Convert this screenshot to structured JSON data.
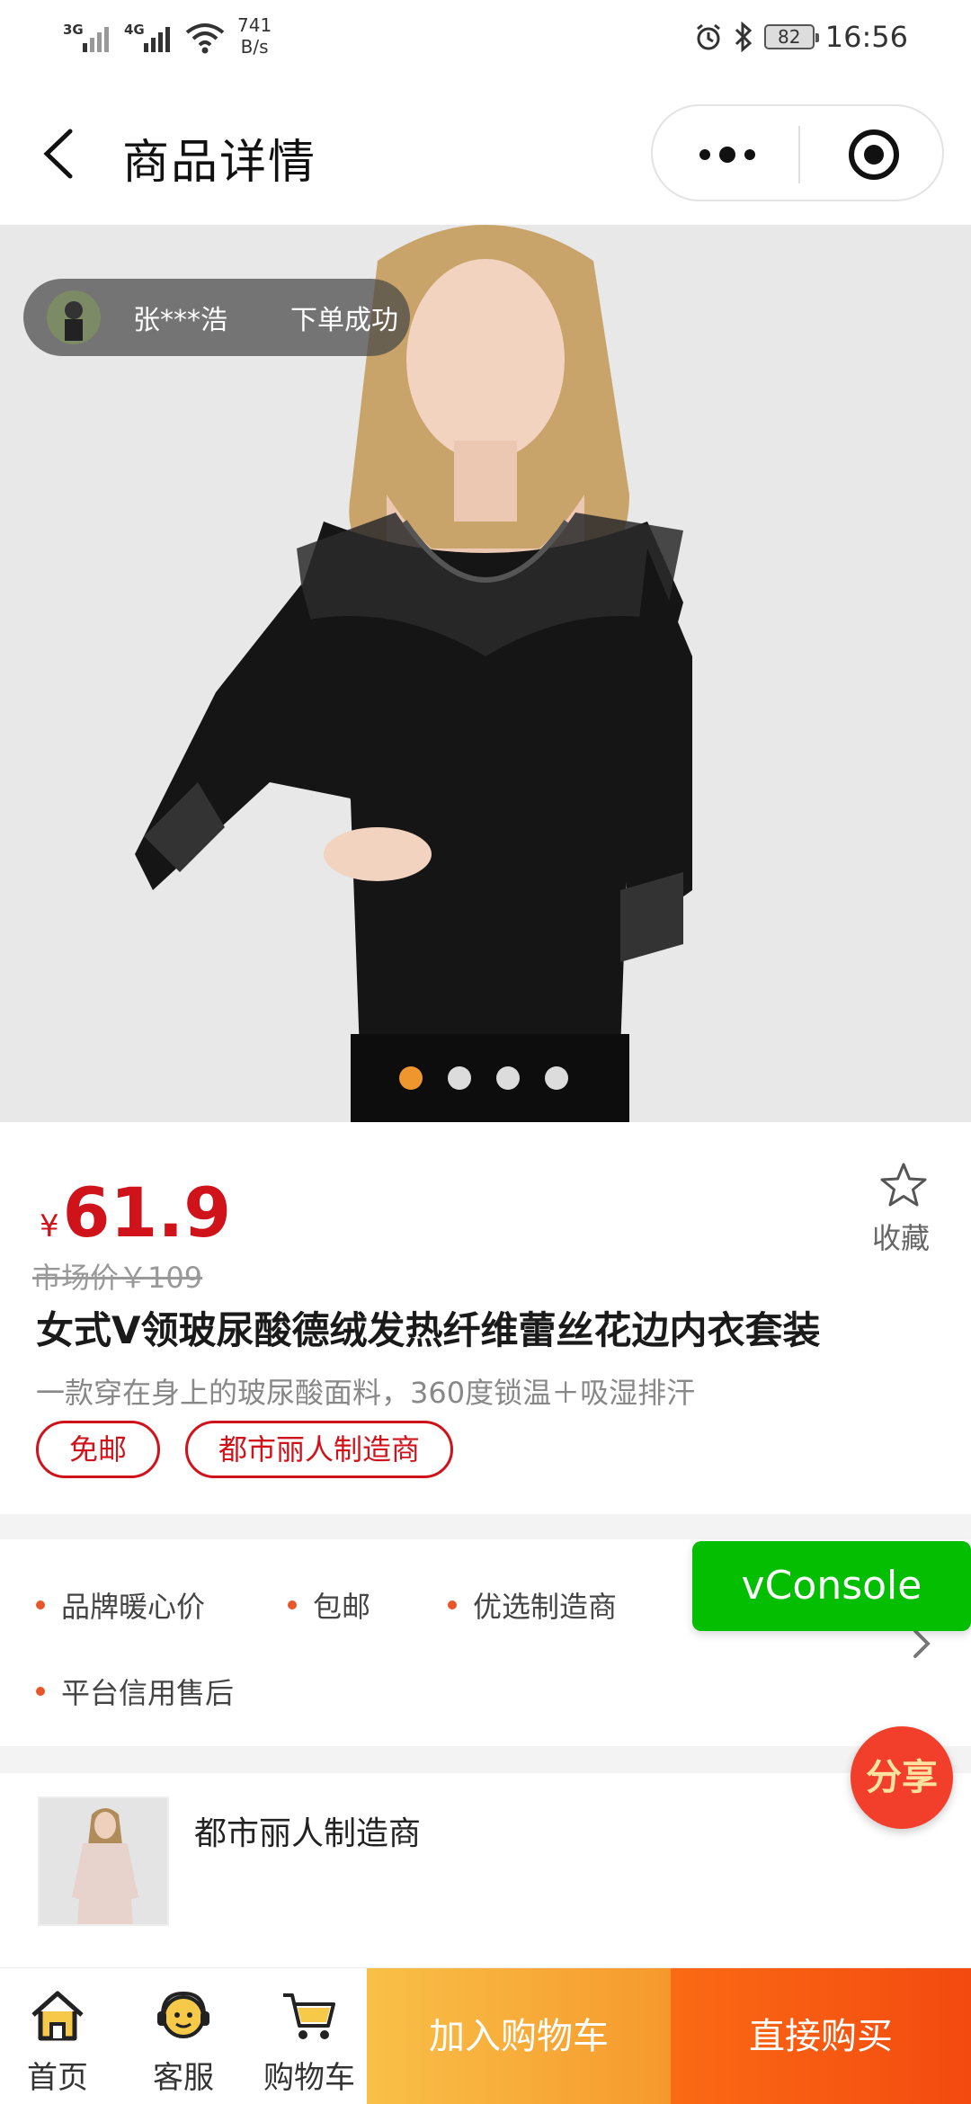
{
  "status_bar": {
    "net1": "3G",
    "net2": "4G",
    "speed_value": "741",
    "speed_unit": "B/s",
    "battery": "82",
    "time": "16:56"
  },
  "nav": {
    "title": "商品详情"
  },
  "toast": {
    "name": "张***浩",
    "message": "下单成功"
  },
  "carousel": {
    "count": 4,
    "active_index": 0
  },
  "product": {
    "currency": "¥",
    "price": "61.9",
    "market_price": "市场价￥109",
    "favorite_label": "收藏",
    "title": "女式V领玻尿酸德绒发热纤维蕾丝花边内衣套装",
    "subtitle": "一款穿在身上的玻尿酸面料，360度锁温＋吸湿排汗",
    "tags": [
      "免邮",
      "都市丽人制造商"
    ]
  },
  "services": [
    "品牌暖心价",
    "包邮",
    "优选制造商",
    "平台信用售后"
  ],
  "vconsole_label": "vConsole",
  "share_label": "分享",
  "shop": {
    "name": "都市丽人制造商"
  },
  "bottom_bar": {
    "tabs": [
      {
        "label": "首页",
        "icon": "home-icon"
      },
      {
        "label": "客服",
        "icon": "customer-service-icon"
      },
      {
        "label": "购物车",
        "icon": "cart-icon"
      }
    ],
    "add_to_cart": "加入购物车",
    "buy_now": "直接购买"
  },
  "colors": {
    "price_red": "#d0121b",
    "dot_active": "#f0962e",
    "vconsole_green": "#04be02",
    "cart_gradient": [
      "#f9c048",
      "#f6992c"
    ],
    "buy_gradient": [
      "#fb6a14",
      "#f34a10"
    ]
  }
}
